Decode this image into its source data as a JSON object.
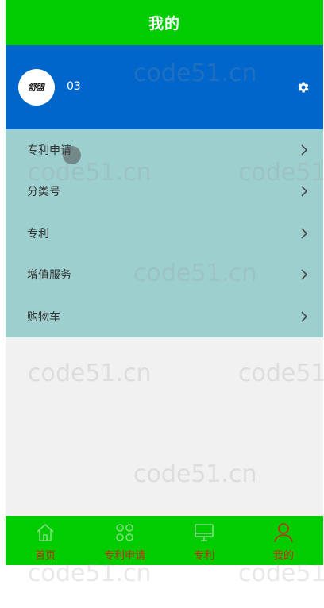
{
  "header": {
    "title": "我的"
  },
  "profile": {
    "avatar_text": "舒盟",
    "username": "03",
    "settings_icon": "gear-icon"
  },
  "menu": {
    "items": [
      {
        "label": "专利申请"
      },
      {
        "label": "分类号"
      },
      {
        "label": "专利"
      },
      {
        "label": "增值服务"
      },
      {
        "label": "购物车"
      }
    ]
  },
  "tabbar": {
    "tabs": [
      {
        "label": "首页",
        "icon": "home-icon"
      },
      {
        "label": "专利申请",
        "icon": "grid-icon"
      },
      {
        "label": "专利",
        "icon": "monitor-icon"
      },
      {
        "label": "我的",
        "icon": "user-icon",
        "active": true
      }
    ]
  },
  "watermark": "code51.cn",
  "colors": {
    "header": "#00cc00",
    "profile": "#0066cc",
    "menu": "#9ecfcf",
    "tab_label": "#c8281a",
    "tab_icon": "#7fdc7f",
    "tab_icon_active": "#c8281a"
  }
}
